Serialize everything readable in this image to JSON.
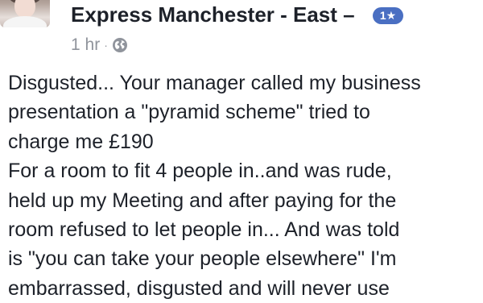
{
  "post": {
    "group_name": "Express Manchester - East –",
    "badge_text": "1★",
    "time": "1 hr",
    "separator": "·",
    "privacy_icon": "globe-icon",
    "body_lines": [
      "Disgusted... Your manager called my business",
      "presentation a \"pyramid scheme\" tried to",
      "charge me £190",
      "For a room to fit 4 people in..and was rude,",
      "held up my Meeting and after paying for the",
      "room refused to let people in... And was told",
      "is \"you can take your people elsewhere\" I'm",
      "embarrassed, disgusted and will never use"
    ]
  },
  "colors": {
    "text": "#1d2129",
    "meta": "#90949c",
    "badge": "#4a6fc2"
  }
}
